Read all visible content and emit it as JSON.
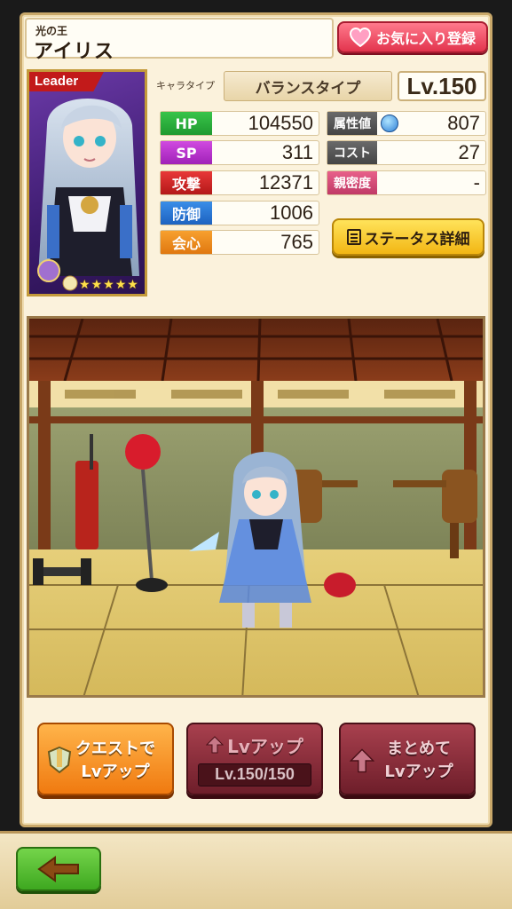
{
  "character": {
    "title": "光の王",
    "name": "アイリス",
    "leader_tag": "Leader",
    "type_label": "キャラタイプ",
    "type_value": "バランスタイプ",
    "level": "Lv.150"
  },
  "favorite_button": {
    "label": "お気に入り登録"
  },
  "stats": {
    "hp": {
      "label": "HP",
      "value": "104550"
    },
    "sp": {
      "label": "SP",
      "value": "311"
    },
    "attack": {
      "label": "攻撃",
      "value": "12371"
    },
    "defense": {
      "label": "防御",
      "value": "1006"
    },
    "critical": {
      "label": "会心",
      "value": "765"
    },
    "attribute": {
      "label": "属性値",
      "value": "807"
    },
    "cost": {
      "label": "コスト",
      "value": "27"
    },
    "affinity": {
      "label": "親密度",
      "value": "-"
    }
  },
  "status_detail_button": {
    "label": "ステータス詳細"
  },
  "rarity_stars": 5,
  "buttons": {
    "quest_lvup": {
      "line1": "クエストで",
      "line2": "Lvアップ"
    },
    "lvup": {
      "line1": "Lvアップ",
      "counter": "Lv.150/150"
    },
    "bulk_lvup": {
      "line1": "まとめて",
      "line2": "Lvアップ"
    }
  },
  "colors": {
    "hp": "#1f9a30",
    "sp": "#a021b8",
    "attack": "#b41818",
    "defense": "#1d62c0",
    "critical": "#e07810",
    "accent_pink": "#e2344d"
  }
}
